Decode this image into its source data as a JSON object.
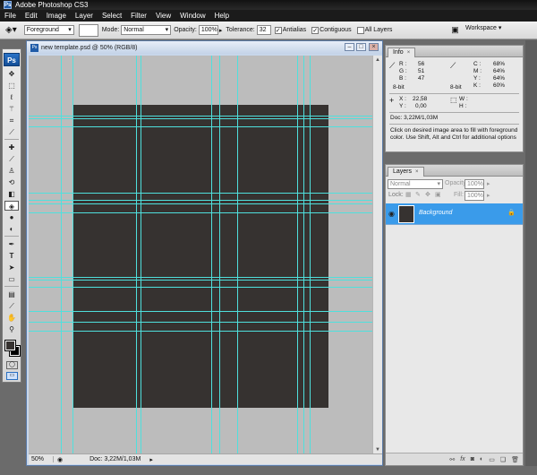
{
  "app": {
    "title": "Adobe Photoshop CS3",
    "logo_text": "Ps"
  },
  "menu": [
    "File",
    "Edit",
    "Image",
    "Layer",
    "Select",
    "Filter",
    "View",
    "Window",
    "Help"
  ],
  "options_bar": {
    "fill_source": "Foreground",
    "mode_label": "Mode:",
    "mode_value": "Normal",
    "opacity_label": "Opacity:",
    "opacity_value": "100%",
    "tolerance_label": "Tolerance:",
    "tolerance_value": "32",
    "antialias_label": "Antialias",
    "antialias_checked": true,
    "contiguous_label": "Contiguous",
    "contiguous_checked": true,
    "all_layers_label": "All Layers",
    "all_layers_checked": false,
    "workspace_label": "Workspace ▾"
  },
  "toolbox": {
    "logo": "Ps",
    "tools": [
      "move-icon",
      "marquee-icon",
      "lasso-icon",
      "magic-wand-icon",
      "crop-icon",
      "eyedropper-icon",
      "healing-brush-icon",
      "brush-icon",
      "clone-stamp-icon",
      "history-brush-icon",
      "eraser-icon",
      "paint-bucket-icon",
      "blur-icon",
      "dodge-icon",
      "pen-icon",
      "type-icon",
      "path-selection-icon",
      "rectangle-icon",
      "notes-icon",
      "eyedropper2-icon",
      "hand-icon",
      "zoom-icon"
    ],
    "foreground_color": "#363230",
    "background_color": "#000000"
  },
  "document": {
    "title": "new template.psd @ 50% (RGB/8)",
    "zoom": "50%",
    "doc_size": "Doc: 3,22M/1,03M",
    "canvas_color": "#363230",
    "guide_color": "#4fe0dd"
  },
  "info_panel": {
    "tab_label": "Info",
    "close": "×",
    "r_label": "R :",
    "r_value": "56",
    "g_label": "G :",
    "g_value": "51",
    "b_label": "B :",
    "b_value": "47",
    "c_label": "C :",
    "c_value": "68%",
    "m_label": "M :",
    "m_value": "64%",
    "y_label": "Y :",
    "y_value": "64%",
    "k_label": "K :",
    "k_value": "60%",
    "bit_left": "8-bit",
    "bit_right": "8-bit",
    "x_label": "X :",
    "x_value": "22,58",
    "y_coord_label": "Y :",
    "y_coord_value": "0,00",
    "w_label": "W :",
    "h_label": "H :",
    "doc_size": "Doc: 3,22M/1,03M",
    "hint": "Click on desired image area to fill with foreground color. Use Shift, Alt and Ctrl for additional options"
  },
  "layers_panel": {
    "tab_label": "Layers",
    "close": "×",
    "blend_mode": "Normal",
    "opacity_label": "Opacity:",
    "opacity_value": "100%",
    "lock_label": "Lock:",
    "fill_label": "Fill:",
    "fill_value": "100%",
    "layer_name": "Background",
    "footer_icons": [
      "link-icon",
      "fx-icon",
      "mask-icon",
      "adjustment-icon",
      "group-icon",
      "new-layer-icon",
      "trash-icon"
    ]
  }
}
